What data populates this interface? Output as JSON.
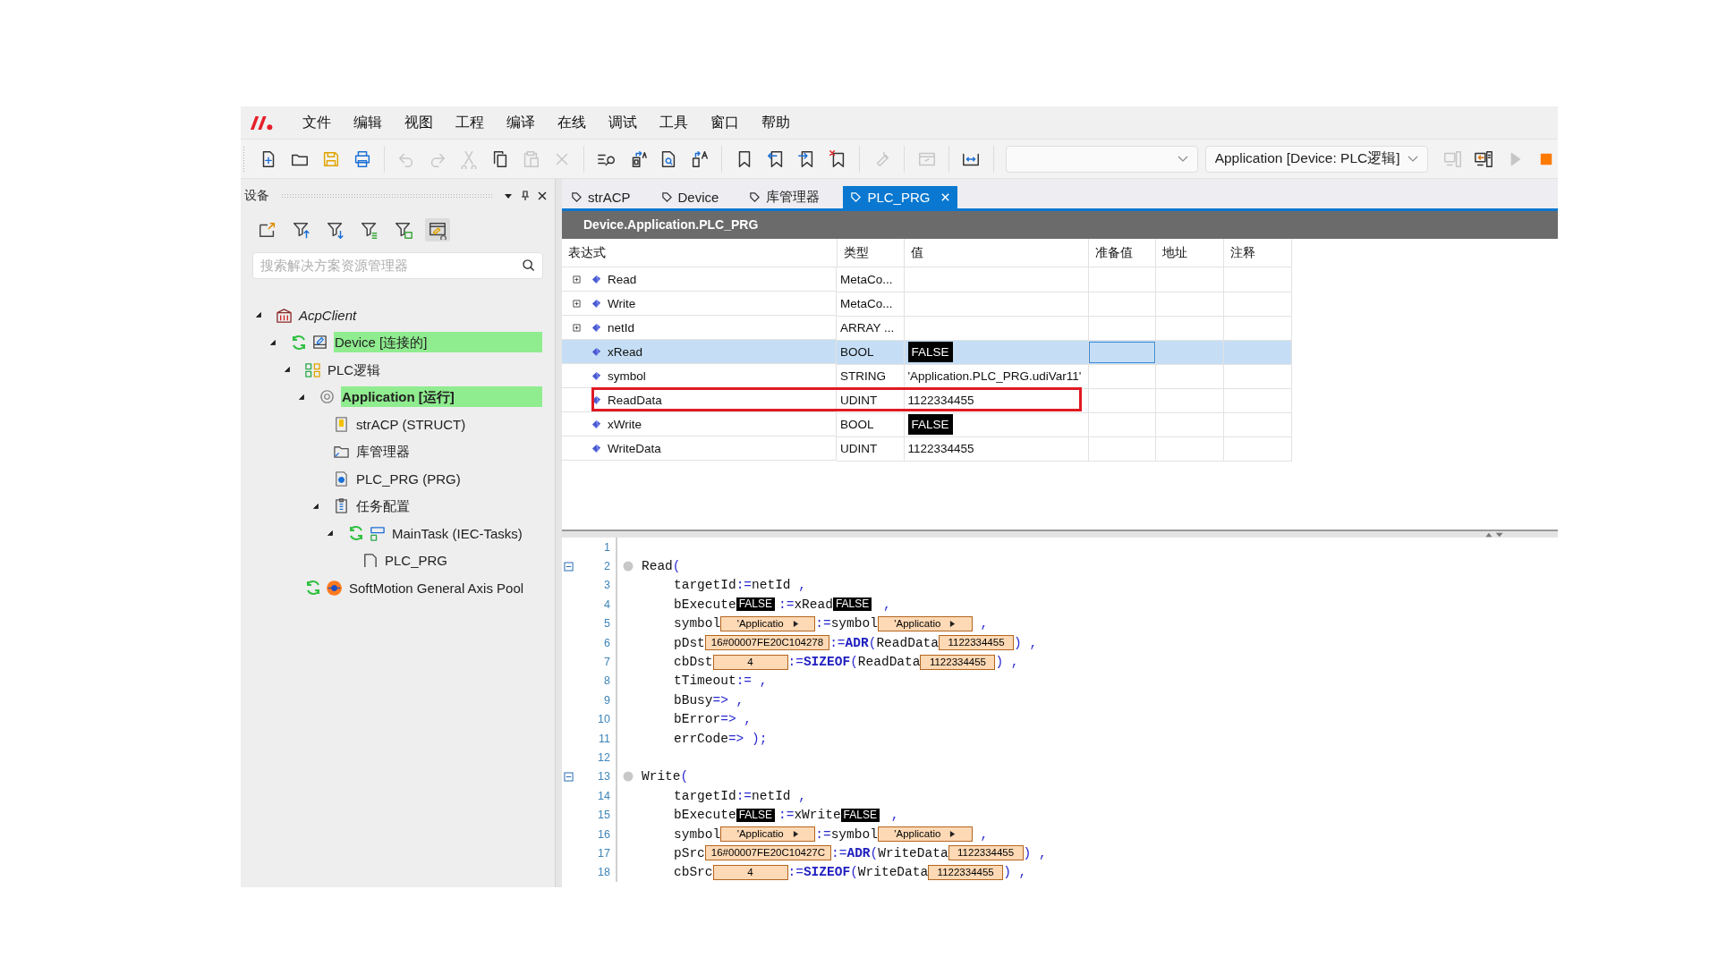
{
  "menu": [
    "文件",
    "编辑",
    "视图",
    "工程",
    "编译",
    "在线",
    "调试",
    "工具",
    "窗口",
    "帮助"
  ],
  "toolbar": {
    "groups": [
      [
        {
          "kind": "new",
          "disabled": false
        },
        {
          "kind": "open",
          "disabled": false
        },
        {
          "kind": "save",
          "disabled": false
        },
        {
          "kind": "print",
          "disabled": false
        }
      ],
      [
        {
          "kind": "undo",
          "disabled": true
        },
        {
          "kind": "redo",
          "disabled": true
        },
        {
          "kind": "cut",
          "disabled": true
        },
        {
          "kind": "copy",
          "disabled": false
        },
        {
          "kind": "paste",
          "disabled": true
        },
        {
          "kind": "delete",
          "disabled": true
        }
      ],
      [
        {
          "kind": "find",
          "disabled": false
        },
        {
          "kind": "clip-letter",
          "disabled": false
        },
        {
          "kind": "doc-search",
          "disabled": false
        },
        {
          "kind": "doc-letter",
          "disabled": false
        }
      ],
      [
        {
          "kind": "bookmark",
          "disabled": false
        },
        {
          "kind": "bookmark-prev",
          "disabled": false
        },
        {
          "kind": "bookmark-next",
          "disabled": false
        },
        {
          "kind": "bookmark-clear",
          "disabled": false
        }
      ],
      [
        {
          "kind": "wrench",
          "disabled": true
        }
      ],
      [
        {
          "kind": "window",
          "disabled": true
        }
      ],
      [
        {
          "kind": "expand",
          "disabled": false
        }
      ]
    ],
    "combo": {
      "value": "Application [Device: PLC逻辑]"
    },
    "online_group": [
      {
        "kind": "login",
        "disabled": true
      },
      {
        "kind": "logout",
        "disabled": false
      },
      {
        "kind": "start",
        "disabled": true
      },
      {
        "kind": "stop",
        "disabled": false
      }
    ]
  },
  "devices_panel": {
    "title": "设备",
    "tools": [
      {
        "kind": "export",
        "selected": false
      },
      {
        "kind": "filter-up",
        "selected": false
      },
      {
        "kind": "filter-down",
        "selected": false
      },
      {
        "kind": "filter-list",
        "selected": false
      },
      {
        "kind": "filter-green",
        "selected": false
      },
      {
        "kind": "window-edit",
        "selected": true
      }
    ],
    "search": {
      "placeholder": "搜索解决方案资源管理器"
    },
    "tree": [
      {
        "label": "AcpClient",
        "kind": "project",
        "synced": false,
        "highlight": false,
        "active": false,
        "expanded": true,
        "children": [
          {
            "label": "Device [连接的]",
            "kind": "device",
            "synced": true,
            "highlight": true,
            "active": false,
            "expanded": true,
            "children": [
              {
                "label": "PLC逻辑",
                "kind": "plc-logic",
                "synced": false,
                "highlight": false,
                "active": false,
                "expanded": true,
                "children": [
                  {
                    "label": "Application [运行]",
                    "kind": "application",
                    "synced": false,
                    "highlight": true,
                    "active": true,
                    "expanded": true,
                    "children": [
                      {
                        "label": "strACP (STRUCT)",
                        "kind": "struct",
                        "synced": false,
                        "highlight": false,
                        "active": false
                      },
                      {
                        "label": "库管理器",
                        "kind": "folder",
                        "synced": false,
                        "highlight": false,
                        "active": false
                      },
                      {
                        "label": "PLC_PRG (PRG)",
                        "kind": "program",
                        "synced": false,
                        "highlight": false,
                        "active": false
                      },
                      {
                        "label": "任务配置",
                        "kind": "task-config",
                        "synced": false,
                        "highlight": false,
                        "active": false,
                        "expanded": true,
                        "children": [
                          {
                            "label": "MainTask (IEC-Tasks)",
                            "kind": "task",
                            "synced": true,
                            "highlight": false,
                            "active": false,
                            "expanded": true,
                            "children": [
                              {
                                "label": "PLC_PRG",
                                "kind": "program-call",
                                "synced": false,
                                "highlight": false,
                                "active": false
                              }
                            ]
                          }
                        ]
                      }
                    ]
                  }
                ]
              },
              {
                "label": "SoftMotion General Axis Pool",
                "kind": "axis-pool",
                "synced": true,
                "highlight": false,
                "active": false
              }
            ]
          }
        ]
      }
    ]
  },
  "tabs": [
    {
      "label": "strACP",
      "selected": false
    },
    {
      "label": "Device",
      "selected": false
    },
    {
      "label": "库管理器",
      "selected": false
    },
    {
      "label": "PLC_PRG",
      "selected": true
    }
  ],
  "editor": {
    "path": "Device.Application.PLC_PRG",
    "columns": [
      "表达式",
      "类型",
      "值",
      "准备值",
      "地址",
      "注释"
    ],
    "rows": [
      {
        "expression": "Read",
        "type": "MetaCo...",
        "kind": "struct",
        "expandable": true,
        "selected": false,
        "marked": false
      },
      {
        "expression": "Write",
        "type": "MetaCo...",
        "kind": "struct",
        "expandable": true,
        "selected": false,
        "marked": false
      },
      {
        "expression": "netId",
        "type": "ARRAY ...",
        "kind": "struct",
        "expandable": true,
        "selected": false,
        "marked": false
      },
      {
        "expression": "xRead",
        "type": "BOOL",
        "value": "FALSE",
        "kind": "bool",
        "expandable": false,
        "selected": true,
        "marked": false
      },
      {
        "expression": "symbol",
        "type": "STRING",
        "value": "'Application.PLC_PRG.udiVar11'",
        "kind": "text",
        "expandable": false,
        "selected": false,
        "marked": false
      },
      {
        "expression": "ReadData",
        "type": "UDINT",
        "value": "1122334455",
        "kind": "text",
        "expandable": false,
        "selected": false,
        "marked": true
      },
      {
        "expression": "xWrite",
        "type": "BOOL",
        "value": "FALSE",
        "kind": "bool",
        "expandable": false,
        "selected": false,
        "marked": false
      },
      {
        "expression": "WriteData",
        "type": "UDINT",
        "value": "1122334455",
        "kind": "text",
        "expandable": false,
        "selected": false,
        "marked": false
      }
    ],
    "code": [
      {
        "number": "1",
        "collapsible": false,
        "breakpoint": false
      },
      {
        "number": "2",
        "collapsible": true,
        "breakpoint": true,
        "indented": false,
        "tokens": [
          {
            "kind": "code",
            "text": "Read"
          },
          {
            "kind": "op",
            "text": "("
          }
        ]
      },
      {
        "number": "3",
        "collapsible": false,
        "breakpoint": false,
        "indented": true,
        "tokens": [
          {
            "kind": "code",
            "text": "targetId"
          },
          {
            "kind": "op",
            "text": ":="
          },
          {
            "kind": "code",
            "text": "netId"
          },
          {
            "kind": "op",
            "text": " ,"
          }
        ]
      },
      {
        "number": "4",
        "collapsible": false,
        "breakpoint": false,
        "indented": true,
        "tokens": [
          {
            "kind": "code",
            "text": "bExecute"
          },
          {
            "kind": "bool",
            "text": "FALSE"
          },
          {
            "kind": "op",
            "text": ":="
          },
          {
            "kind": "code",
            "text": "xRead"
          },
          {
            "kind": "bool",
            "text": "FALSE"
          },
          {
            "kind": "op",
            "text": " ,"
          }
        ]
      },
      {
        "number": "5",
        "collapsible": false,
        "breakpoint": false,
        "indented": true,
        "tokens": [
          {
            "kind": "code",
            "text": "symbol"
          },
          {
            "kind": "monitor_string",
            "text": "'Applicatio"
          },
          {
            "kind": "op",
            "text": ":="
          },
          {
            "kind": "code",
            "text": "symbol"
          },
          {
            "kind": "monitor_string",
            "text": "'Applicatio"
          },
          {
            "kind": "op",
            "text": " ,"
          }
        ]
      },
      {
        "number": "6",
        "collapsible": false,
        "breakpoint": false,
        "indented": true,
        "tokens": [
          {
            "kind": "code",
            "text": "pDst"
          },
          {
            "kind": "monitor",
            "text": "16#00007FE20C104278"
          },
          {
            "kind": "op",
            "text": ":="
          },
          {
            "kind": "func",
            "text": "ADR"
          },
          {
            "kind": "op",
            "text": "("
          },
          {
            "kind": "code",
            "text": "ReadData"
          },
          {
            "kind": "monitor",
            "text": "1122334455"
          },
          {
            "kind": "op",
            "text": ")"
          },
          {
            "kind": "op",
            "text": " ,"
          }
        ]
      },
      {
        "number": "7",
        "collapsible": false,
        "breakpoint": false,
        "indented": true,
        "tokens": [
          {
            "kind": "code",
            "text": "cbDst"
          },
          {
            "kind": "monitor",
            "text": "4"
          },
          {
            "kind": "op",
            "text": ":="
          },
          {
            "kind": "func",
            "text": "SIZEOF"
          },
          {
            "kind": "op",
            "text": "("
          },
          {
            "kind": "code",
            "text": "ReadData"
          },
          {
            "kind": "monitor",
            "text": "1122334455"
          },
          {
            "kind": "op",
            "text": ")"
          },
          {
            "kind": "op",
            "text": " ,"
          }
        ]
      },
      {
        "number": "8",
        "collapsible": false,
        "breakpoint": false,
        "indented": true,
        "tokens": [
          {
            "kind": "code",
            "text": "tTimeout"
          },
          {
            "kind": "op",
            "text": ":= ,"
          }
        ]
      },
      {
        "number": "9",
        "collapsible": false,
        "breakpoint": false,
        "indented": true,
        "tokens": [
          {
            "kind": "code",
            "text": "bBusy"
          },
          {
            "kind": "op",
            "text": "=> ,"
          }
        ]
      },
      {
        "number": "10",
        "collapsible": false,
        "breakpoint": false,
        "indented": true,
        "tokens": [
          {
            "kind": "code",
            "text": "bError"
          },
          {
            "kind": "op",
            "text": "=> ,"
          }
        ]
      },
      {
        "number": "11",
        "collapsible": false,
        "breakpoint": false,
        "indented": true,
        "tokens": [
          {
            "kind": "code",
            "text": "errCode"
          },
          {
            "kind": "op",
            "text": "=> );"
          }
        ]
      },
      {
        "number": "12",
        "collapsible": false,
        "breakpoint": false
      },
      {
        "number": "13",
        "collapsible": true,
        "breakpoint": true,
        "indented": false,
        "tokens": [
          {
            "kind": "code",
            "text": "Write"
          },
          {
            "kind": "op",
            "text": "("
          }
        ]
      },
      {
        "number": "14",
        "collapsible": false,
        "breakpoint": false,
        "indented": true,
        "tokens": [
          {
            "kind": "code",
            "text": "targetId"
          },
          {
            "kind": "op",
            "text": ":="
          },
          {
            "kind": "code",
            "text": "netId"
          },
          {
            "kind": "op",
            "text": " ,"
          }
        ]
      },
      {
        "number": "15",
        "collapsible": false,
        "breakpoint": false,
        "indented": true,
        "tokens": [
          {
            "kind": "code",
            "text": "bExecute"
          },
          {
            "kind": "bool",
            "text": "FALSE"
          },
          {
            "kind": "op",
            "text": ":="
          },
          {
            "kind": "code",
            "text": "xWrite"
          },
          {
            "kind": "bool",
            "text": "FALSE"
          },
          {
            "kind": "op",
            "text": " ,"
          }
        ]
      },
      {
        "number": "16",
        "collapsible": false,
        "breakpoint": false,
        "indented": true,
        "tokens": [
          {
            "kind": "code",
            "text": "symbol"
          },
          {
            "kind": "monitor_string",
            "text": "'Applicatio"
          },
          {
            "kind": "op",
            "text": ":="
          },
          {
            "kind": "code",
            "text": "symbol"
          },
          {
            "kind": "monitor_string",
            "text": "'Applicatio"
          },
          {
            "kind": "op",
            "text": " ,"
          }
        ]
      },
      {
        "number": "17",
        "collapsible": false,
        "breakpoint": false,
        "indented": true,
        "tokens": [
          {
            "kind": "code",
            "text": "pSrc"
          },
          {
            "kind": "monitor",
            "text": "16#00007FE20C10427C"
          },
          {
            "kind": "op",
            "text": ":="
          },
          {
            "kind": "func",
            "text": "ADR"
          },
          {
            "kind": "op",
            "text": "("
          },
          {
            "kind": "code",
            "text": "WriteData"
          },
          {
            "kind": "monitor",
            "text": "1122334455"
          },
          {
            "kind": "op",
            "text": ")"
          },
          {
            "kind": "op",
            "text": " ,"
          }
        ]
      },
      {
        "number": "18",
        "collapsible": false,
        "breakpoint": false,
        "indented": true,
        "tokens": [
          {
            "kind": "code",
            "text": "cbSrc"
          },
          {
            "kind": "monitor",
            "text": "4"
          },
          {
            "kind": "op",
            "text": ":="
          },
          {
            "kind": "func",
            "text": "SIZEOF"
          },
          {
            "kind": "op",
            "text": "("
          },
          {
            "kind": "code",
            "text": "WriteData"
          },
          {
            "kind": "monitor",
            "text": "1122334455"
          },
          {
            "kind": "op",
            "text": ")"
          },
          {
            "kind": "op",
            "text": " ,"
          }
        ]
      }
    ]
  }
}
